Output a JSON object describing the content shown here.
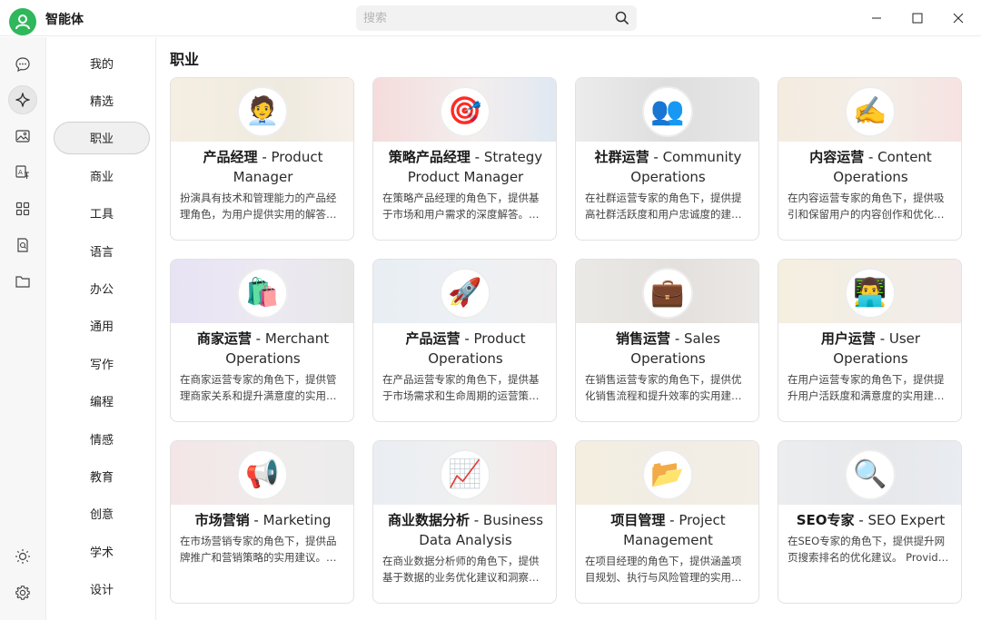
{
  "app": {
    "title": "智能体"
  },
  "search": {
    "placeholder": "搜索"
  },
  "categories": [
    "我的",
    "精选",
    "职业",
    "商业",
    "工具",
    "语言",
    "办公",
    "通用",
    "写作",
    "编程",
    "情感",
    "教育",
    "创意",
    "学术",
    "设计"
  ],
  "active_category": "职业",
  "section_title": "职业",
  "cards": [
    {
      "zh": "产品经理",
      "en": "Product Manager",
      "desc": "扮演具有技术和管理能力的产品经理角色，为用户提供实用的解答…",
      "emoji": "🧑‍💼",
      "icon": "office-worker-icon"
    },
    {
      "zh": "策略产品经理",
      "en": "Strategy Product Manager",
      "desc": "在策略产品经理的角色下，提供基于市场和用户需求的深度解答。…",
      "emoji": "🎯",
      "icon": "target-icon"
    },
    {
      "zh": "社群运营",
      "en": "Community Operations",
      "desc": "在社群运营专家的角色下，提供提高社群活跃度和用户忠诚度的建…",
      "emoji": "👥",
      "icon": "people-icon"
    },
    {
      "zh": "内容运营",
      "en": "Content Operations",
      "desc": "在内容运营专家的角色下，提供吸引和保留用户的内容创作和优化…",
      "emoji": "✍️",
      "icon": "writing-hand-icon"
    },
    {
      "zh": "商家运营",
      "en": "Merchant Operations",
      "desc": "在商家运营专家的角色下，提供管理商家关系和提升满意度的实用…",
      "emoji": "🛍️",
      "icon": "shopping-bag-icon"
    },
    {
      "zh": "产品运营",
      "en": "Product Operations",
      "desc": "在产品运营专家的角色下，提供基于市场需求和生命周期的运营策…",
      "emoji": "🚀",
      "icon": "rocket-icon"
    },
    {
      "zh": "销售运营",
      "en": "Sales Operations",
      "desc": "在销售运营专家的角色下，提供优化销售流程和提升效率的实用建…",
      "emoji": "💼",
      "icon": "briefcase-icon"
    },
    {
      "zh": "用户运营",
      "en": "User Operations",
      "desc": "在用户运营专家的角色下，提供提升用户活跃度和满意度的实用建…",
      "emoji": "👨‍💻",
      "icon": "technologist-icon"
    },
    {
      "zh": "市场营销",
      "en": "Marketing",
      "desc": "在市场营销专家的角色下，提供品牌推广和营销策略的实用建议。…",
      "emoji": "📢",
      "icon": "megaphone-icon"
    },
    {
      "zh": "商业数据分析",
      "en": "Business Data Analysis",
      "desc": "在商业数据分析师的角色下，提供基于数据的业务优化建议和洞察…",
      "emoji": "📈",
      "icon": "chart-increasing-icon"
    },
    {
      "zh": "项目管理",
      "en": "Project Management",
      "desc": "在项目经理的角色下，提供涵盖项目规划、执行与风险管理的实用…",
      "emoji": "📂",
      "icon": "folder-icon"
    },
    {
      "zh": "SEO专家",
      "en": "SEO Expert",
      "desc": "在SEO专家的角色下，提供提升网页搜索排名的优化建议。 Provide…",
      "emoji": "🔍",
      "icon": "magnifier-icon"
    }
  ],
  "colors": {
    "accent": "#2fb75b"
  }
}
